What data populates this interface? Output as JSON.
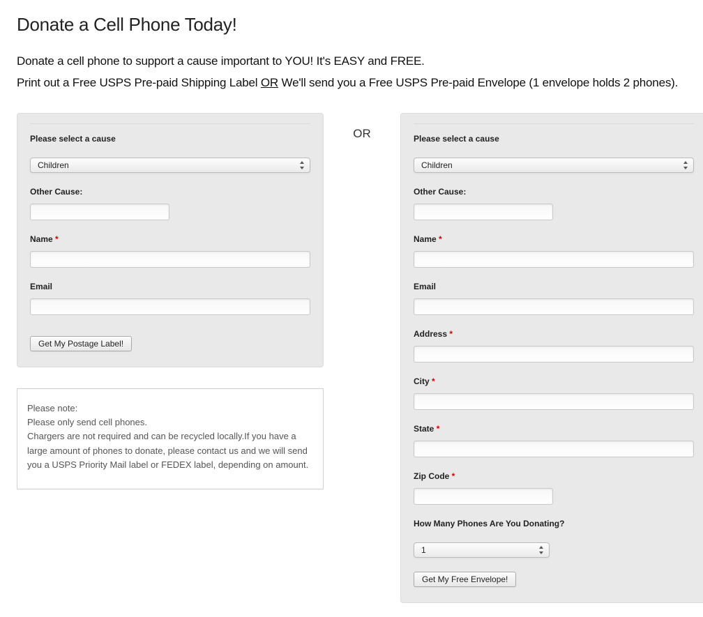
{
  "page": {
    "title": "Donate a Cell Phone Today!",
    "intro_line1": "Donate a cell phone to support a cause important to YOU! It's EASY and FREE.",
    "intro_line2_a": "Print out a Free USPS Pre-paid Shipping Label ",
    "intro_line2_or": "OR",
    "intro_line2_b": " We'll send you a Free USPS Pre-paid Envelope (1 envelope holds 2 phones).",
    "separator": "OR"
  },
  "form_left": {
    "select_cause_label": "Please select a cause",
    "cause_value": "Children",
    "other_cause_label": "Other Cause:",
    "other_cause_value": "",
    "name_label": "Name ",
    "name_value": "",
    "email_label": "Email",
    "email_value": "",
    "submit_label": "Get My Postage Label!"
  },
  "form_right": {
    "select_cause_label": "Please select a cause",
    "cause_value": "Children",
    "other_cause_label": "Other Cause:",
    "other_cause_value": "",
    "name_label": "Name ",
    "name_value": "",
    "email_label": "Email",
    "email_value": "",
    "address_label": "Address ",
    "address_value": "",
    "city_label": "City ",
    "city_value": "",
    "state_label": "State ",
    "state_value": "",
    "zip_label": "Zip Code ",
    "zip_value": "",
    "phones_label": "How Many Phones Are You Donating?",
    "phones_value": "1",
    "submit_label": "Get My Free Envelope!"
  },
  "note": {
    "l1": "Please note:",
    "l2": "Please only send cell phones.",
    "l3": "Chargers are not required and can be recycled locally.If you have a large amount of phones to donate, please contact us and we will send you a USPS Priority Mail label or FEDEX label, depending on amount."
  },
  "asterisk": "*"
}
